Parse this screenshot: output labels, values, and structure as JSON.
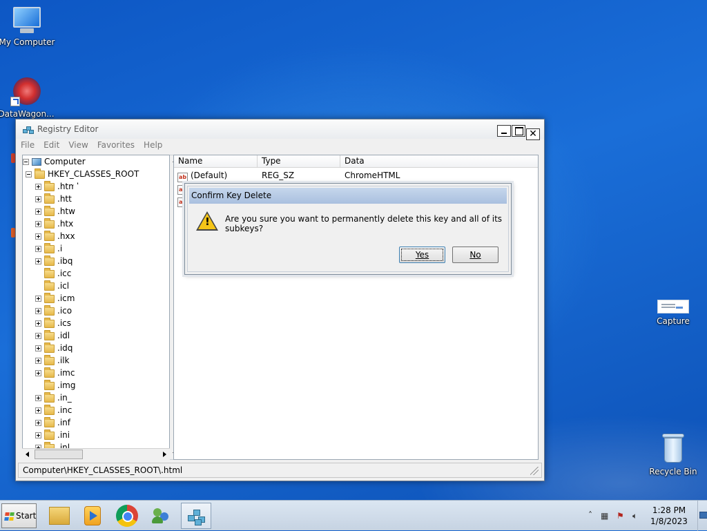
{
  "desktop": {
    "icons": {
      "my_computer": "My Computer",
      "datawagon": "DataWagon...",
      "capture": "Capture",
      "recycle_bin": "Recycle Bin"
    }
  },
  "window": {
    "title": "Registry Editor",
    "menu": [
      "File",
      "Edit",
      "View",
      "Favorites",
      "Help"
    ],
    "tree": {
      "root": "Computer",
      "hive": "HKEY_CLASSES_ROOT",
      "keys": [
        ".html",
        ".htt",
        ".htw",
        ".htx",
        ".hxx",
        ".i",
        ".ibq",
        ".icc",
        ".icl",
        ".icm",
        ".ico",
        ".ics",
        ".idl",
        ".idq",
        ".ilk",
        ".imc",
        ".img",
        ".in_",
        ".inc",
        ".inf",
        ".ini",
        ".inl"
      ],
      "no_expander": [
        ".icc",
        ".icl",
        ".img"
      ]
    },
    "list": {
      "columns": [
        "Name",
        "Type",
        "Data"
      ],
      "rows": [
        {
          "name": "(Default)",
          "type": "REG_SZ",
          "data": "ChromeHTML"
        }
      ]
    },
    "status": "Computer\\HKEY_CLASSES_ROOT\\.html"
  },
  "dialog": {
    "title": "Confirm Key Delete",
    "message": "Are you sure you want to permanently delete this key and all of its subkeys?",
    "yes": "Yes",
    "no": "No"
  },
  "taskbar": {
    "start": "Start",
    "pinned": [
      "explorer-icon",
      "media-player-icon",
      "chrome-icon",
      "users-icon",
      "registry-editor-icon"
    ],
    "tray": {
      "time": "1:28 PM",
      "date": "1/8/2023"
    }
  },
  "colors": {
    "desktop_top": "#0d57c4",
    "dialog_title": "#a9c0df",
    "folder": "#e6b84a"
  }
}
